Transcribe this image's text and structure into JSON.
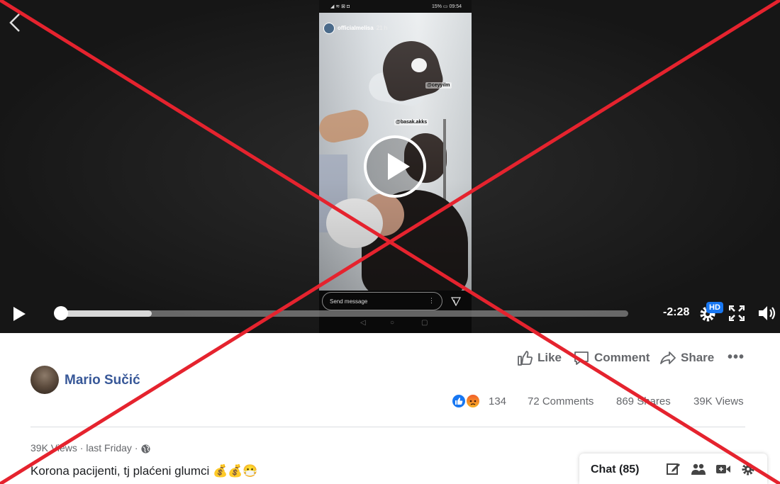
{
  "phone": {
    "status_left": "◢ ≋ ⊠ ◘",
    "status_right": "15% ▭ 09:54",
    "story_user": "officialmelisa",
    "story_time": "21 h",
    "tags": [
      "@ceyyilm",
      "@basak.akks"
    ],
    "send_placeholder": "Send message",
    "send_dots": "⋮",
    "nav_keys": [
      "◁",
      "○",
      "▢"
    ]
  },
  "player": {
    "remaining": "-2:28",
    "hd": "HD",
    "progress_fraction": 0.16,
    "icons": [
      "back-arrow-icon",
      "play-icon",
      "settings-gear-icon",
      "fullscreen-icon",
      "volume-icon"
    ]
  },
  "actions": {
    "like": "Like",
    "comment": "Comment",
    "share": "Share",
    "more": "•••"
  },
  "author": {
    "name": "Mario Sučić"
  },
  "stats": {
    "reactions_count": "134",
    "comments": "72 Comments",
    "shares": "869 Shares",
    "views": "39K Views"
  },
  "meta": {
    "views": "39K Views",
    "separator": "·",
    "time": "last Friday"
  },
  "caption": "Korona pacijenti, tj plaćeni glumci 💰💰😷",
  "chat": {
    "label": "Chat (85)"
  },
  "colors": {
    "facebook_blue": "#1877f2",
    "author_link": "#385898",
    "overlay_red": "#e5232e"
  }
}
